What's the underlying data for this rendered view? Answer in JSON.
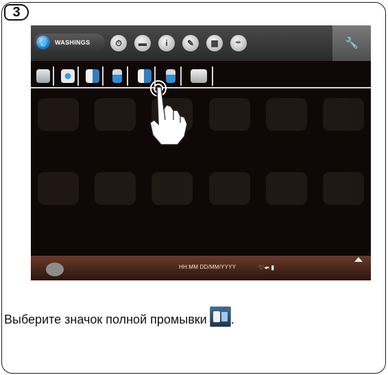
{
  "step_number": "3",
  "screen": {
    "active_tab_label": "WASHINGS",
    "top_icons": [
      "clock-icon",
      "message-icon",
      "info-icon",
      "pencil-icon",
      "calendar-icon",
      "coffee-machine-icon"
    ],
    "settings_icon": "wrench-icon",
    "washing_options": [
      "cup-wash-icon",
      "cup-rinse-icon",
      "milk-carafe-icon",
      "glass-icon",
      "full-wash-icon",
      "glass-rinse-icon",
      "descale-icon"
    ],
    "selected_option": "full-wash-icon",
    "datetime_text": "HH:MM DD/MM/YYYY",
    "status_icons": "♡◂▪ ▮"
  },
  "instruction": {
    "text": "Выберите значок полной промывки",
    "suffix": "."
  },
  "colors": {
    "screen_bg": "#0f0806",
    "topbar_bg": "#333333",
    "accent_blue": "#1f7fd1",
    "bottombar_bg": "#4a2718"
  }
}
